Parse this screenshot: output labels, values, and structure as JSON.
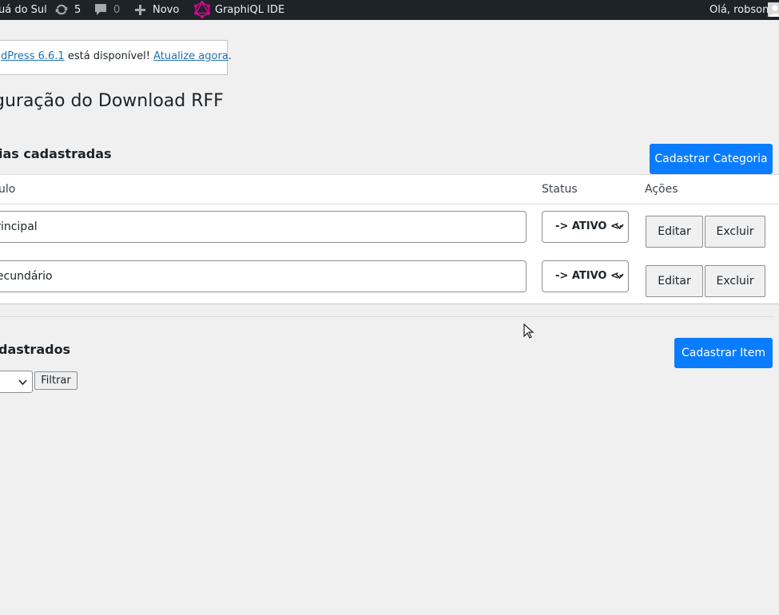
{
  "admin_bar": {
    "site_name": "uá do Sul",
    "updates_count": "5",
    "comments_count": "0",
    "new_label": "Novo",
    "graphiql_label": "GraphiQL IDE",
    "greeting": "Olá, robson"
  },
  "notice": {
    "prefix": "dPress 6.6.1",
    "middle": " está disponível! ",
    "link": "Atualize agora",
    "suffix": "."
  },
  "page_title": "guração do Download RFF",
  "categories": {
    "heading": "ias cadastradas",
    "add_button": "Cadastrar Categoria",
    "columns": {
      "title": "ulo",
      "status": "Status",
      "actions": "Ações"
    },
    "rows": [
      {
        "title": "Principal",
        "status": "-> ATIVO <-",
        "edit": "Editar",
        "delete": "Excluir"
      },
      {
        "title": "Secundário",
        "status": "-> ATIVO <-",
        "edit": "Editar",
        "delete": "Excluir"
      }
    ]
  },
  "items": {
    "heading": "dastrados",
    "add_button": "Cadastrar Item",
    "filter_button": "Filtrar"
  },
  "colors": {
    "primary": "#0a7cff",
    "admin_bar": "#1d2327",
    "graphiql": "#e10098"
  },
  "icons": [
    "updates-icon",
    "comment-icon",
    "plus-icon",
    "graphiql-icon",
    "avatar",
    "chevron-down-icon",
    "mouse-cursor-icon"
  ]
}
